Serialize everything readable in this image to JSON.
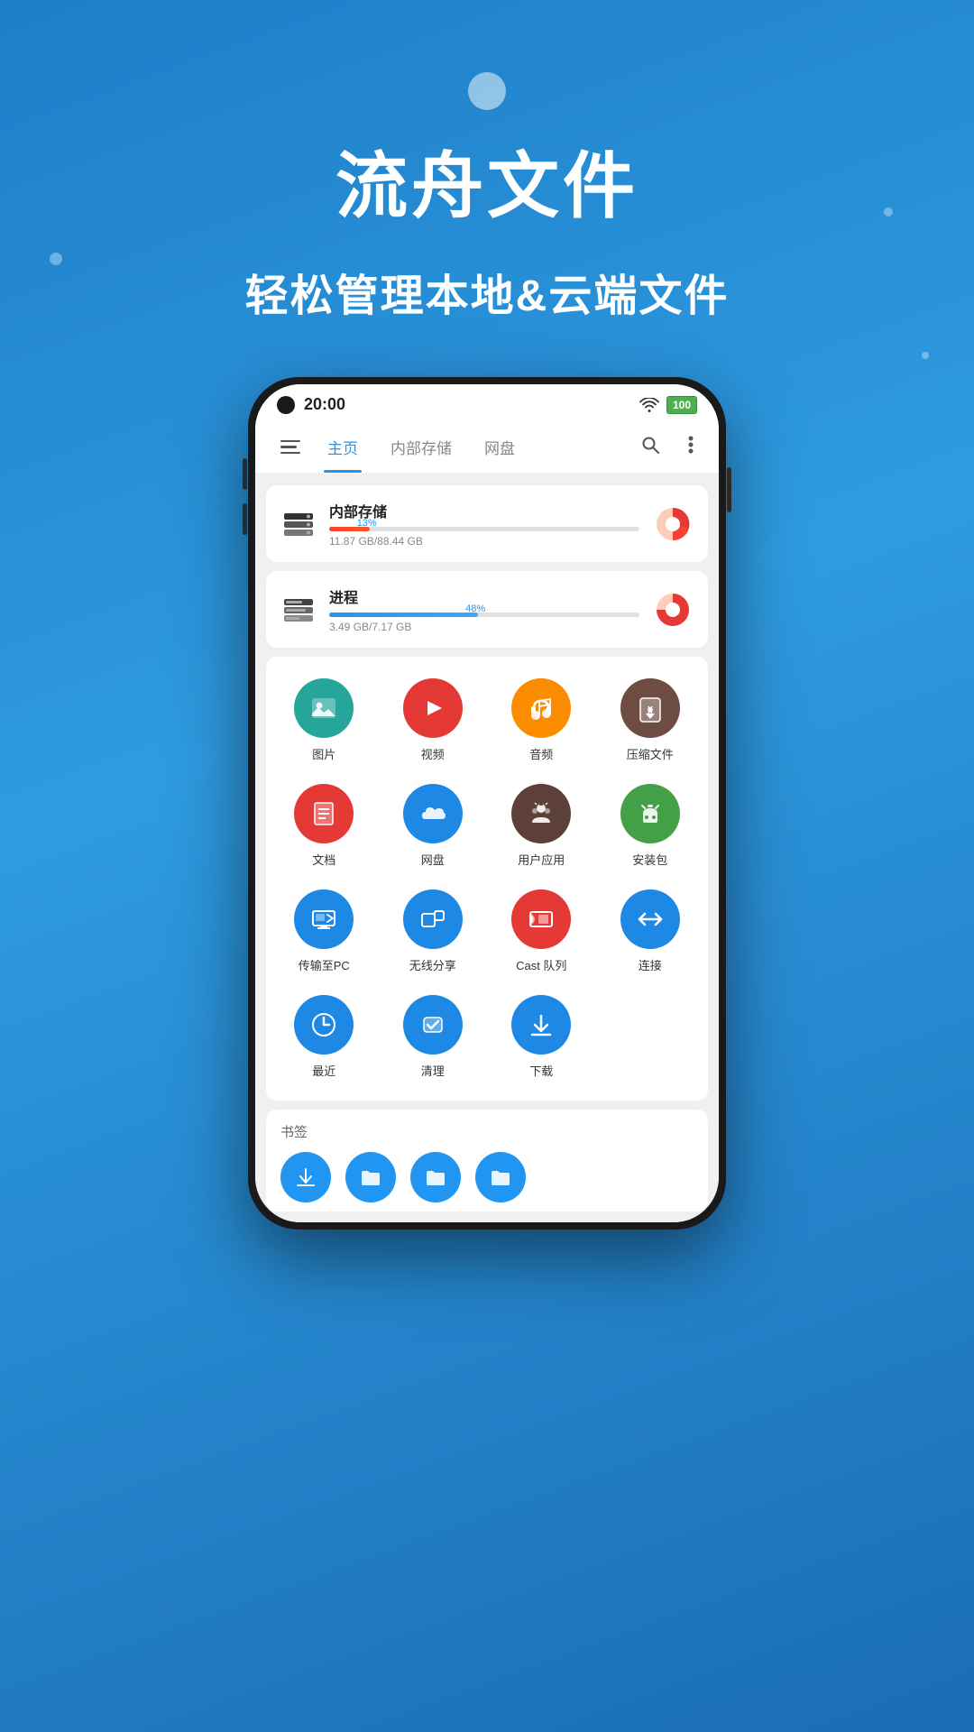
{
  "app": {
    "title": "流舟文件",
    "subtitle": "轻松管理本地&云端文件"
  },
  "status_bar": {
    "time": "20:00",
    "battery_label": "100"
  },
  "nav": {
    "tabs": [
      {
        "id": "home",
        "label": "主页",
        "active": true
      },
      {
        "id": "internal",
        "label": "内部存储",
        "active": false
      },
      {
        "id": "cloud",
        "label": "网盘",
        "active": false
      }
    ]
  },
  "storage_cards": [
    {
      "name": "内部存储",
      "progress_pct": 13,
      "progress_label": "13%",
      "size_text": "11.87 GB/88.44 GB",
      "type": "internal"
    },
    {
      "name": "进程",
      "progress_pct": 48,
      "progress_label": "48%",
      "size_text": "3.49 GB/7.17 GB",
      "type": "process"
    }
  ],
  "app_grid": [
    {
      "id": "photos",
      "label": "图片",
      "bg": "#26a69a",
      "icon": "🖼"
    },
    {
      "id": "video",
      "label": "视频",
      "bg": "#e53935",
      "icon": "▶"
    },
    {
      "id": "audio",
      "label": "音频",
      "bg": "#fb8c00",
      "icon": "🎧"
    },
    {
      "id": "archive",
      "label": "压缩文件",
      "bg": "#6d4c41",
      "icon": "⬇"
    },
    {
      "id": "docs",
      "label": "文档",
      "bg": "#e53935",
      "icon": "📄"
    },
    {
      "id": "netdisk",
      "label": "网盘",
      "bg": "#1e88e5",
      "icon": "☁"
    },
    {
      "id": "apps",
      "label": "用户应用",
      "bg": "#5d4037",
      "icon": "🤖"
    },
    {
      "id": "apk",
      "label": "安装包",
      "bg": "#43a047",
      "icon": "🤖"
    },
    {
      "id": "topc",
      "label": "传输至PC",
      "bg": "#1e88e5",
      "icon": "💻"
    },
    {
      "id": "wireless",
      "label": "无线分享",
      "bg": "#1e88e5",
      "icon": "📱"
    },
    {
      "id": "cast",
      "label": "Cast 队列",
      "bg": "#e53935",
      "icon": "📡"
    },
    {
      "id": "connect",
      "label": "连接",
      "bg": "#1e88e5",
      "icon": "↔"
    },
    {
      "id": "recent",
      "label": "最近",
      "bg": "#1e88e5",
      "icon": "🕐"
    },
    {
      "id": "clean",
      "label": "清理",
      "bg": "#1e88e5",
      "icon": "✔"
    },
    {
      "id": "download",
      "label": "下载",
      "bg": "#1e88e5",
      "icon": "⬇"
    }
  ],
  "bookmarks": {
    "title": "书签",
    "items": [
      {
        "icon": "⬇",
        "bg": "#1e88e5"
      },
      {
        "icon": "📁",
        "bg": "#1e88e5"
      },
      {
        "icon": "📁",
        "bg": "#1e88e5"
      },
      {
        "icon": "📁",
        "bg": "#1e88e5"
      }
    ]
  }
}
